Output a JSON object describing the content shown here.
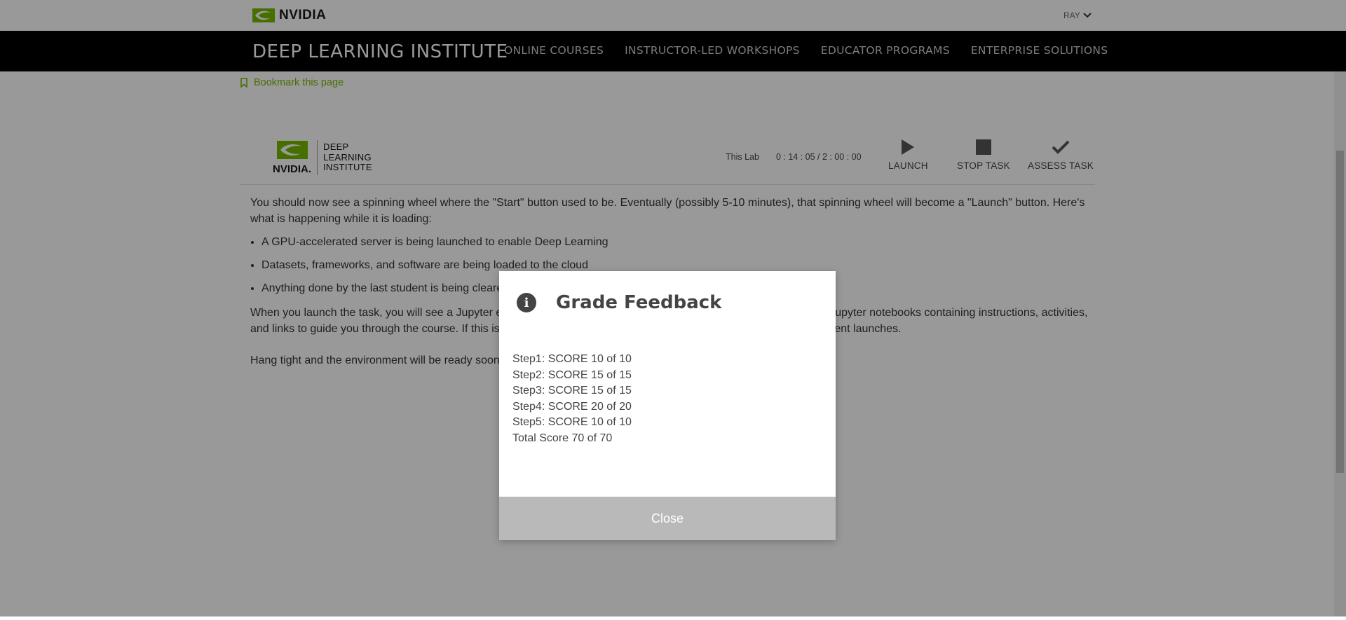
{
  "topbar": {
    "logo_text": "NVIDIA",
    "user_label": "RAY"
  },
  "navbar": {
    "brand": "DEEP LEARNING INSTITUTE",
    "items": [
      "ONLINE COURSES",
      "INSTRUCTOR-LED WORKSHOPS",
      "EDUCATOR PROGRAMS",
      "ENTERPRISE SOLUTIONS"
    ]
  },
  "bookmark": {
    "label": "Bookmark this page"
  },
  "lab": {
    "logo_nvidia": "NVIDIA.",
    "logo_line1": "DEEP",
    "logo_line2": "LEARNING",
    "logo_line3": "INSTITUTE",
    "timer_label": "This Lab",
    "timer_value": "0 : 14 : 05 / 2 : 00 : 00",
    "launch_label": "LAUNCH",
    "stop_label": "STOP TASK",
    "assess_label": "ASSESS TASK",
    "para1": "You should now see a spinning wheel where the \"Start\" button used to be. Eventually (possibly 5-10 minutes), that spinning wheel will become a \"Launch\" button. Here's what is happening while it is loading:",
    "bullets": [
      "A GPU-accelerated server is being launched to enable Deep Learning",
      "Datasets, frameworks, and software are being loaded to the cloud",
      "Anything done by the last student is being cleared"
    ],
    "para2": "When you launch the task, you will see a Jupyter environment in a new browser tab. You will see a list of folders and Jupyter notebooks containing instructions, activities, and links to guide you through the course. If this is your first time doing this, feel free to experiment once the environment launches.",
    "para3": "Hang tight and the environment will be ready soon!"
  },
  "modal": {
    "title": "Grade Feedback",
    "lines": [
      "Step1: SCORE 10 of 10",
      "Step2: SCORE 15 of 15",
      "Step3: SCORE 15 of 15",
      "Step4: SCORE 20 of 20",
      "Step5: SCORE 10 of 10",
      "Total Score 70 of 70"
    ],
    "close_label": "Close"
  },
  "colors": {
    "accent": "#76b900",
    "nav_bg": "#000000",
    "modal_footer": "#b9b9b9"
  }
}
